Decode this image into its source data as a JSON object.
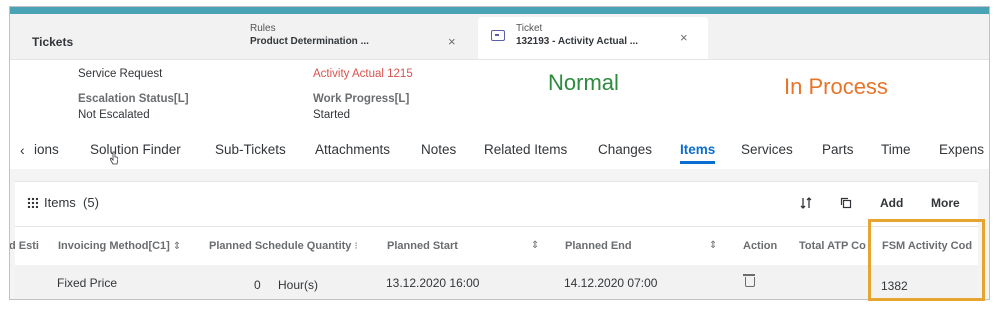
{
  "tabs": {
    "home_label": "Tickets",
    "rules": {
      "line1": "Rules",
      "line2": "Product Determination ..."
    },
    "ticket": {
      "line1": "Ticket",
      "line2": "132193 - Activity Actual ..."
    },
    "close_glyph": "×"
  },
  "header": {
    "service_request": {
      "label": "Service Request"
    },
    "activity_actual": {
      "value": "Activity Actual 1215"
    },
    "escalation": {
      "label": "Escalation Status[L]",
      "value": "Not Escalated"
    },
    "work_progress": {
      "label": "Work Progress[L]",
      "value": "Started"
    },
    "priority_text": "Normal",
    "status_text": "In Process",
    "colors": {
      "priority": "#2e8b3e",
      "status": "#e8742a",
      "activity": "#d9534f"
    }
  },
  "section_tabs": {
    "scroll_left_glyph": "‹",
    "items": [
      "ions",
      "Solution Finder",
      "Sub-Tickets",
      "Attachments",
      "Notes",
      "Related Items",
      "Changes",
      "Items",
      "Services",
      "Parts",
      "Time",
      "Expens"
    ],
    "active": "Items"
  },
  "items_panel": {
    "title": "Items",
    "count": "(5)",
    "toolbar": {
      "add": "Add",
      "more": "More",
      "sort_icon": "sort-icon",
      "copy_icon": "copy-icon"
    },
    "columns": [
      "d Esti",
      "Invoicing Method[C1]",
      "Planned Schedule Quantity",
      "Planned Start",
      "Planned End",
      "Action",
      "Total ATP Co",
      "FSM Activity Cod"
    ],
    "rows": [
      {
        "invoicing_method": "Fixed Price",
        "quantity": "0",
        "unit": "Hour(s)",
        "planned_start": "13.12.2020 16:00",
        "planned_end": "14.12.2020 07:00",
        "fsm_activity": "1382"
      }
    ]
  }
}
